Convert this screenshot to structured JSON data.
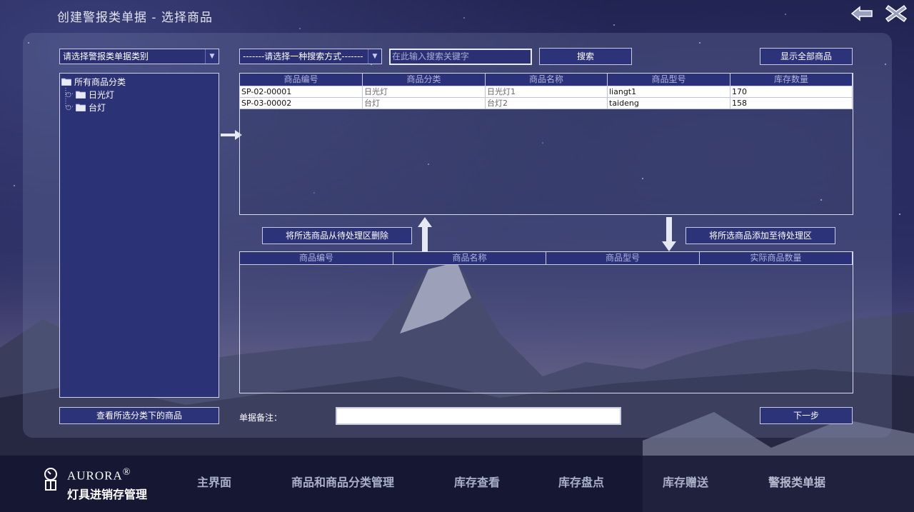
{
  "window": {
    "title": "创建警报类单据 - 选择商品",
    "back_icon": "back-arrow-icon",
    "close_icon": "close-icon"
  },
  "toolbar": {
    "category_select": "请选择警报类单据类别",
    "search_mode_select": "-------请选择一种搜索方式-------",
    "search_placeholder": "在此输入搜索关键字",
    "search_button": "搜索",
    "show_all_button": "显示全部商品"
  },
  "tree": {
    "root": "所有商品分类",
    "children": [
      "日光灯",
      "台灯"
    ]
  },
  "goods_table": {
    "columns": [
      "商品编号",
      "商品分类",
      "商品名称",
      "商品型号",
      "库存数量"
    ],
    "rows": [
      [
        "SP-02-00001",
        "日光灯",
        "日光灯1",
        "liangt1",
        "170"
      ],
      [
        "SP-03-00002",
        "台灯",
        "台灯2",
        "taideng",
        "158"
      ]
    ]
  },
  "actions": {
    "remove_button": "将所选商品从待处理区删除",
    "add_button": "将所选商品添加至待处理区"
  },
  "pending_table": {
    "columns": [
      "商品编号",
      "商品名称",
      "商品型号",
      "实际商品数量"
    ]
  },
  "bottom": {
    "view_category_button": "查看所选分类下的商品",
    "note_label": "单据备注：",
    "note_value": "",
    "next_button": "下一步"
  },
  "footer": {
    "brand": "AURORA",
    "brand_mark": "®",
    "subtitle": "灯具进销存管理",
    "nav": [
      "主界面",
      "商品和商品分类管理",
      "库存查看",
      "库存盘点",
      "库存赠送",
      "警报类单据"
    ]
  },
  "colors": {
    "panel_bg": "#2c3276",
    "accent_border": "#c7cbe6"
  }
}
